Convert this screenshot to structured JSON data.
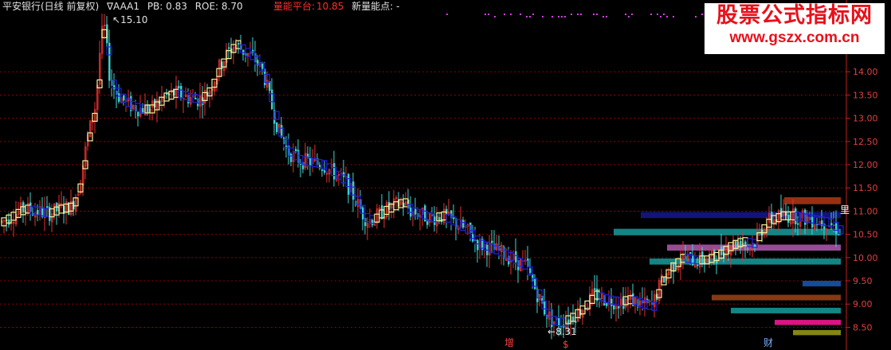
{
  "header": {
    "stock_title": "平安银行(日线 前复权)",
    "indicator_name": "∇AAA1",
    "pb": "PB: 0.83",
    "roe": "ROE: 8.70",
    "volume_platform_label": "量能平台:",
    "volume_platform_value": "10.85",
    "new_volume_point": "新量能点: -"
  },
  "watermark": {
    "line1": "股票公式指标网",
    "line2": "www.gszx.com.cn"
  },
  "axis": {
    "ticks": [
      "14.00",
      "13.50",
      "13.00",
      "12.50",
      "12.00",
      "11.50",
      "11.00",
      "10.50",
      "10.00",
      "9.50",
      "9.00",
      "8.50"
    ],
    "right_marker": "里"
  },
  "annotations": {
    "high_label": "15.10",
    "low_label": "8.31",
    "marker_add": "增",
    "marker_dollar": "$",
    "marker_finance": "财"
  },
  "colors": {
    "background": "#000000",
    "up_candle": "#e83030",
    "down_candle": "#3fd6d6",
    "step_up": "#f5f5a0",
    "step_down": "#2222dd",
    "grid": "#8b0000",
    "axis_text": "#e04040"
  },
  "chart_data": {
    "type": "candlestick",
    "ylim": [
      8.3,
      15.2
    ],
    "y_ticks": [
      14.0,
      13.5,
      13.0,
      12.5,
      12.0,
      11.5,
      11.0,
      10.5,
      10.0,
      9.5,
      9.0,
      8.5
    ],
    "high": 15.1,
    "low": 8.31,
    "volume_profile_bars": [
      {
        "price_low": 11.15,
        "price_high": 11.3,
        "color": "#a03214"
      },
      {
        "price_low": 10.85,
        "price_high": 10.98,
        "color": "#141480"
      },
      {
        "price_low": 10.48,
        "price_high": 10.62,
        "color": "#148c8c"
      },
      {
        "price_low": 10.15,
        "price_high": 10.28,
        "color": "#a050a0"
      },
      {
        "price_low": 9.85,
        "price_high": 9.98,
        "color": "#148c8c"
      },
      {
        "price_low": 9.38,
        "price_high": 9.5,
        "color": "#1450a0"
      },
      {
        "price_low": 9.08,
        "price_high": 9.2,
        "color": "#8c3c14"
      },
      {
        "price_low": 8.8,
        "price_high": 8.92,
        "color": "#148c8c"
      },
      {
        "price_low": 8.55,
        "price_high": 8.66,
        "color": "#e8148c"
      },
      {
        "price_low": 8.33,
        "price_high": 8.44,
        "color": "#8c8c14"
      }
    ],
    "price_path": [
      [
        0,
        10.75
      ],
      [
        15,
        10.9
      ],
      [
        30,
        11.05
      ],
      [
        45,
        11.0
      ],
      [
        60,
        10.95
      ],
      [
        75,
        11.05
      ],
      [
        90,
        11.1
      ],
      [
        100,
        11.6
      ],
      [
        110,
        12.6
      ],
      [
        120,
        13.3
      ],
      [
        125,
        14.4
      ],
      [
        130,
        15.1
      ],
      [
        138,
        13.8
      ],
      [
        148,
        13.5
      ],
      [
        160,
        13.3
      ],
      [
        175,
        13.2
      ],
      [
        190,
        13.2
      ],
      [
        205,
        13.45
      ],
      [
        220,
        13.55
      ],
      [
        235,
        13.45
      ],
      [
        250,
        13.4
      ],
      [
        262,
        13.6
      ],
      [
        275,
        14.1
      ],
      [
        285,
        14.4
      ],
      [
        295,
        14.6
      ],
      [
        305,
        14.45
      ],
      [
        318,
        14.3
      ],
      [
        330,
        14.0
      ],
      [
        340,
        13.3
      ],
      [
        350,
        12.7
      ],
      [
        360,
        12.3
      ],
      [
        375,
        12.1
      ],
      [
        390,
        12.05
      ],
      [
        405,
        12.0
      ],
      [
        420,
        11.8
      ],
      [
        435,
        11.6
      ],
      [
        450,
        11.1
      ],
      [
        460,
        10.8
      ],
      [
        470,
        10.85
      ],
      [
        480,
        11.0
      ],
      [
        492,
        11.1
      ],
      [
        505,
        11.2
      ],
      [
        515,
        11.0
      ],
      [
        525,
        10.95
      ],
      [
        540,
        10.85
      ],
      [
        555,
        10.9
      ],
      [
        570,
        10.75
      ],
      [
        585,
        10.6
      ],
      [
        600,
        10.3
      ],
      [
        615,
        10.2
      ],
      [
        630,
        10.1
      ],
      [
        645,
        9.95
      ],
      [
        660,
        9.8
      ],
      [
        672,
        9.3
      ],
      [
        682,
        8.9
      ],
      [
        692,
        8.65
      ],
      [
        702,
        8.6
      ],
      [
        715,
        8.7
      ],
      [
        730,
        8.9
      ],
      [
        745,
        9.2
      ],
      [
        760,
        9.1
      ],
      [
        775,
        9.05
      ],
      [
        790,
        9.1
      ],
      [
        805,
        9.0
      ],
      [
        818,
        8.95
      ],
      [
        830,
        9.5
      ],
      [
        842,
        9.8
      ],
      [
        855,
        10.0
      ],
      [
        870,
        9.95
      ],
      [
        885,
        9.95
      ],
      [
        900,
        10.05
      ],
      [
        915,
        10.25
      ],
      [
        930,
        10.35
      ],
      [
        945,
        10.3
      ],
      [
        955,
        10.6
      ],
      [
        965,
        10.8
      ],
      [
        980,
        10.9
      ],
      [
        995,
        10.9
      ],
      [
        1010,
        10.85
      ],
      [
        1025,
        10.8
      ],
      [
        1040,
        10.75
      ],
      [
        1052,
        10.6
      ]
    ]
  }
}
